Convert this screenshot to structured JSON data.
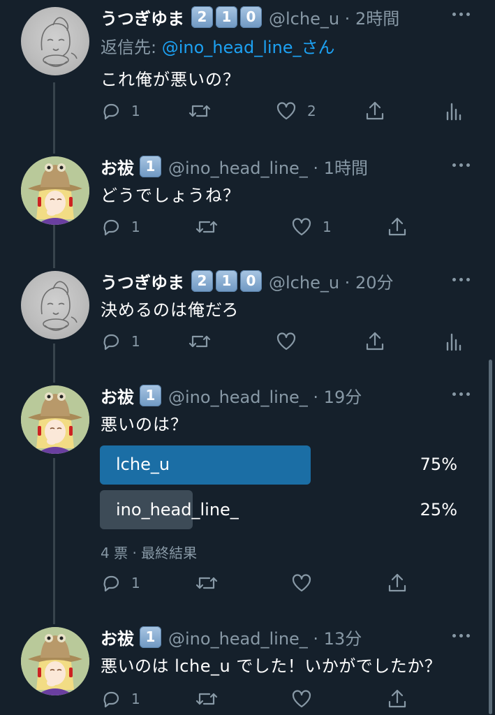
{
  "tweets": [
    {
      "name": "うつぎゆま",
      "badges": [
        "2",
        "1",
        "0"
      ],
      "handle": "@lche_u · 2時間",
      "reply_to": {
        "prefix": "返信先: ",
        "mention": "@ino_head_line_さん"
      },
      "text": "これ俺が悪いの？",
      "actions": {
        "reply": "1",
        "retweet": "",
        "like": "2"
      }
    },
    {
      "name": "お祓",
      "badges": [
        "1"
      ],
      "handle": "@ino_head_line_ · 1時間",
      "text": "どうでしょうね？",
      "actions": {
        "reply": "1",
        "retweet": "",
        "like": "1"
      }
    },
    {
      "name": "うつぎゆま",
      "badges": [
        "2",
        "1",
        "0"
      ],
      "handle": "@lche_u · 20分",
      "text": "決めるのは俺だろ",
      "actions": {
        "reply": "1",
        "retweet": "",
        "like": ""
      }
    },
    {
      "name": "お祓",
      "badges": [
        "1"
      ],
      "handle": "@ino_head_line_ · 19分",
      "text": "悪いのは？",
      "poll": {
        "options": [
          {
            "label": "lche_u",
            "percent_text": "75%",
            "percent": 75,
            "winner": true
          },
          {
            "label": "ino_head_line_",
            "percent_text": "25%",
            "percent": 25,
            "winner": false
          }
        ],
        "meta": "4 票 · 最終結果"
      },
      "actions": {
        "reply": "1",
        "retweet": "",
        "like": ""
      }
    },
    {
      "name": "お祓",
      "badges": [
        "1"
      ],
      "handle": "@ino_head_line_ · 13分",
      "text": "悪いのは lche_u でした！いかがでしたか？",
      "actions": {
        "reply": "1",
        "retweet": "",
        "like": ""
      }
    }
  ],
  "colors": {
    "background": "#15202b",
    "secondary_text": "#8899a6",
    "link": "#1da1f2",
    "poll_winner": "#1b6ea5",
    "poll_other": "#3d4b57"
  },
  "icons": [
    "reply-icon",
    "retweet-icon",
    "like-icon",
    "share-icon",
    "analytics-icon",
    "more-icon"
  ]
}
